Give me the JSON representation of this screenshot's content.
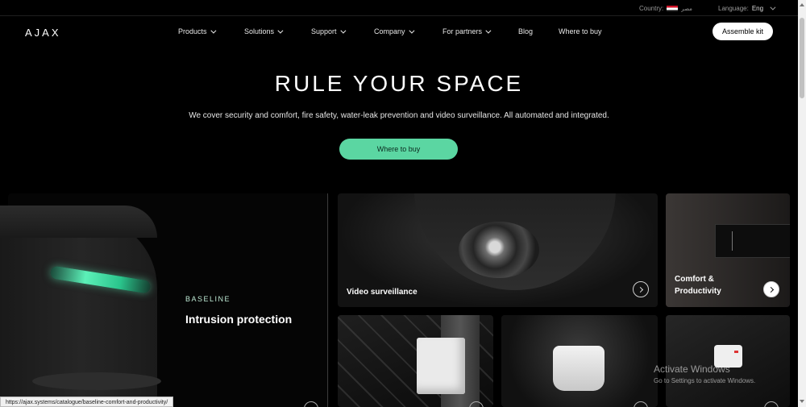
{
  "topbar": {
    "country_label": "Country:",
    "country_name": "مصر",
    "language_label": "Language:",
    "language_value": "Eng"
  },
  "header": {
    "logo": "AJAX",
    "nav": [
      {
        "label": "Products",
        "has_dropdown": true
      },
      {
        "label": "Solutions",
        "has_dropdown": true
      },
      {
        "label": "Support",
        "has_dropdown": true
      },
      {
        "label": "Company",
        "has_dropdown": true
      },
      {
        "label": "For partners",
        "has_dropdown": true
      },
      {
        "label": "Blog",
        "has_dropdown": false
      },
      {
        "label": "Where to buy",
        "has_dropdown": false
      }
    ],
    "assemble_label": "Assemble kit"
  },
  "hero": {
    "title": "RULE YOUR SPACE",
    "subtitle": "We cover security and comfort, fire safety, water-leak prevention and video surveillance. All automated and integrated.",
    "cta_label": "Where to buy"
  },
  "cards": {
    "main": {
      "eyebrow": "BASELINE",
      "title": "Intrusion protection"
    },
    "video": {
      "title": "Video surveillance"
    },
    "comfort": {
      "title_line1": "Comfort &",
      "title_line2": "Productivity"
    }
  },
  "watermark": {
    "title": "Activate Windows",
    "subtitle": "Go to Settings to activate Windows."
  },
  "statusbar": {
    "url": "https://ajax.systems/catalogue/baseline-comfort-and-productivity/"
  },
  "colors": {
    "background": "#000000",
    "accent": "#5bd6a2",
    "text": "#ffffff"
  }
}
